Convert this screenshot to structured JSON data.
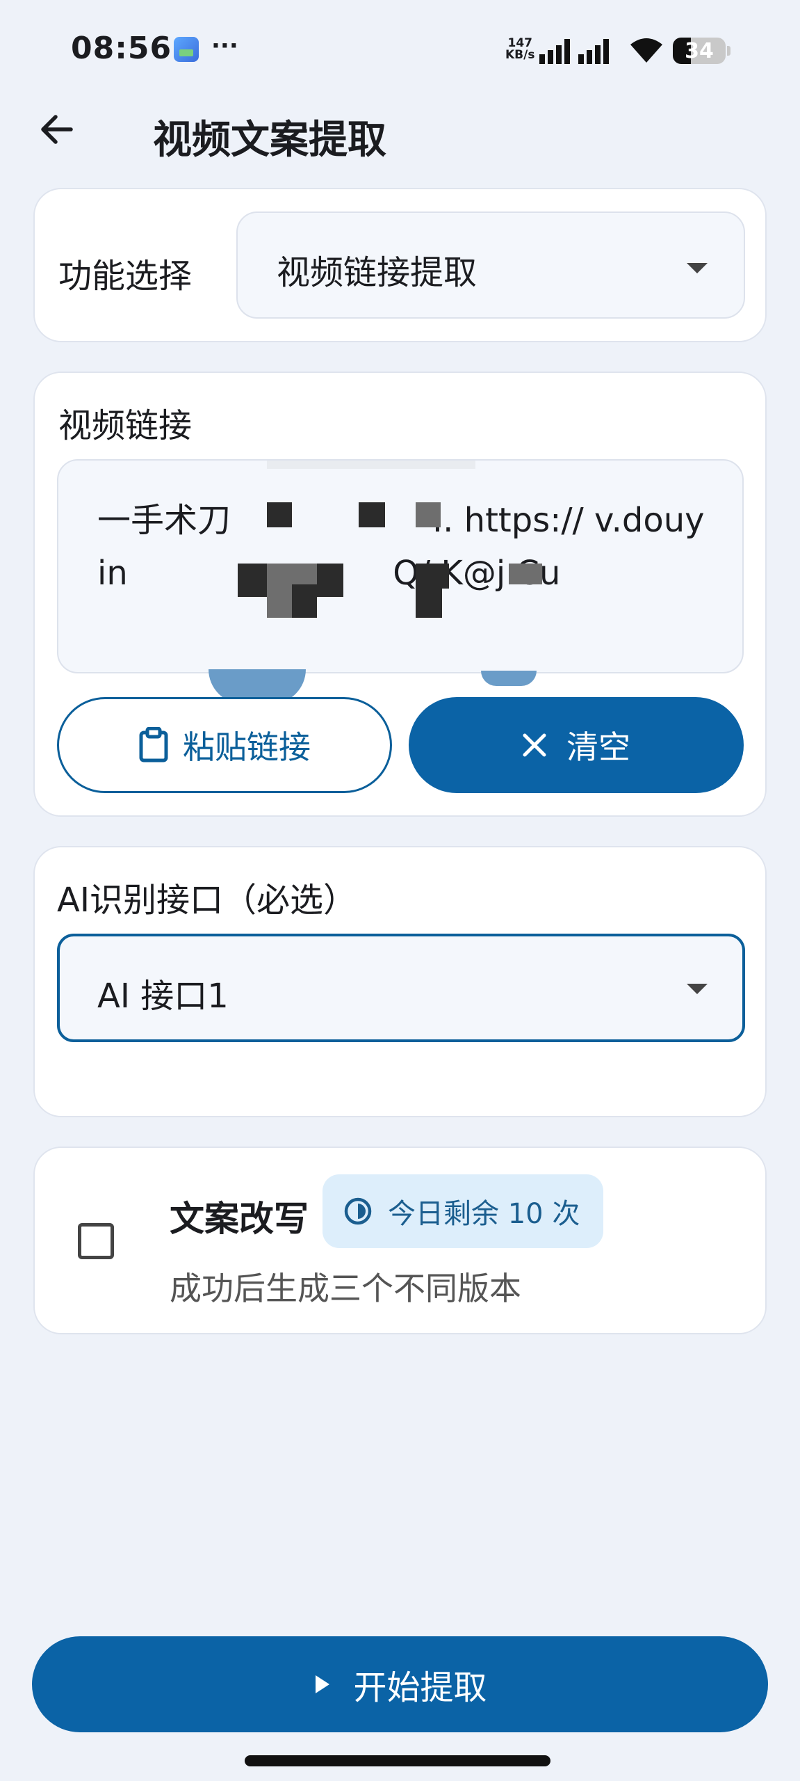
{
  "status_bar": {
    "time": "08:56",
    "more": "···",
    "speed_value": "147",
    "speed_unit": "KB/s",
    "battery": "34"
  },
  "header": {
    "title": "视频文案提取",
    "back_icon": "arrow-left-icon"
  },
  "function_card": {
    "label": "功能选择",
    "selected": "视频链接提取"
  },
  "link_card": {
    "label": "视频链接",
    "link_text": "一手术刀                   .. https:// v.douyin                         Q/ K@j.Cu",
    "paste_label": "粘贴链接",
    "clear_label": "清空"
  },
  "ai_card": {
    "label": "AI识别接口（必选）",
    "selected": "AI 接口1"
  },
  "rewrite_card": {
    "title": "文案改写",
    "badge": "今日剩余 10 次",
    "remaining": 10,
    "subtitle": "成功后生成三个不同版本",
    "checked": false
  },
  "start_button": {
    "label": "开始提取"
  },
  "colors": {
    "primary": "#0b63a6",
    "background": "#eef2f9",
    "badge_bg": "#ddeefb"
  }
}
